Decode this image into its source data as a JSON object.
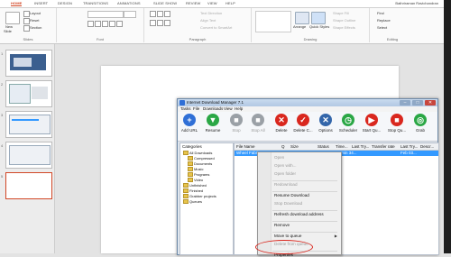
{
  "ribbon": {
    "tabs": [
      "HOME",
      "INSERT",
      "DESIGN",
      "TRANSITIONS",
      "ANIMATIONS",
      "SLIDE SHOW",
      "REVIEW",
      "VIEW",
      "HELP"
    ],
    "account": "Bathriraman Ravichandran",
    "slides_group": {
      "new_slide": "New",
      "new_slide_sub": "Slide",
      "layout": "Layout",
      "reset": "Reset",
      "section": "Section",
      "label": "Slides"
    },
    "font_label": "Font",
    "paragraph_group": {
      "text_direction": "Text Direction",
      "align_text": "Align Text",
      "convert_smartart": "Convert to SmartArt",
      "label": "Paragraph"
    },
    "drawing_group": {
      "arrange": "Arrange",
      "quick_styles": "Quick Styles",
      "shape_fill": "Shape Fill",
      "shape_outline": "Shape Outline",
      "shape_effects": "Shape Effects",
      "label": "Drawing"
    },
    "editing_group": {
      "find": "Find",
      "replace": "Replace",
      "select": "Select",
      "label": "Editing"
    },
    "accent_color": "#d24726"
  },
  "thumbnails": {
    "numbers": [
      "1",
      "2",
      "3",
      "4",
      "5"
    ]
  },
  "idm": {
    "title": "Internet Download Manager 7.1",
    "menu": [
      "Tasks",
      "File",
      "Downloads",
      "View",
      "Help"
    ],
    "toolbar": [
      {
        "label": "Add URL",
        "icon": "add-url-icon",
        "glyph": "+",
        "color": "#2f6fd6",
        "dim": false
      },
      {
        "label": "Resume",
        "icon": "resume-icon",
        "glyph": "▼",
        "color": "#2aa745",
        "dim": false
      },
      {
        "label": "Stop",
        "icon": "stop-icon",
        "glyph": "■",
        "color": "#9aa0a6",
        "dim": true
      },
      {
        "label": "Stop All",
        "icon": "stop-all-icon",
        "glyph": "■",
        "color": "#9aa0a6",
        "dim": true
      },
      {
        "label": "Delete",
        "icon": "delete-icon",
        "glyph": "✕",
        "color": "#d9271e",
        "dim": false
      },
      {
        "label": "Delete C...",
        "icon": "delete-completed-icon",
        "glyph": "✓",
        "color": "#d9271e",
        "dim": false
      },
      {
        "label": "Options",
        "icon": "options-icon",
        "glyph": "✕",
        "color": "#3366aa",
        "dim": false
      },
      {
        "label": "Scheduler",
        "icon": "scheduler-icon",
        "glyph": "◷",
        "color": "#2aa745",
        "dim": false
      },
      {
        "label": "Start Qu...",
        "icon": "start-queue-icon",
        "glyph": "▶",
        "color": "#d9271e",
        "dim": false
      },
      {
        "label": "Stop Qu...",
        "icon": "stop-queue-icon",
        "glyph": "■",
        "color": "#d9271e",
        "dim": false
      },
      {
        "label": "Grab",
        "icon": "grabber-icon",
        "glyph": "◎",
        "color": "#2aa745",
        "dim": false
      }
    ],
    "categories_title": "Categories",
    "categories": [
      {
        "label": "All Downloads",
        "indent": 0
      },
      {
        "label": "Compressed",
        "indent": 1
      },
      {
        "label": "Documents",
        "indent": 1
      },
      {
        "label": "Music",
        "indent": 1
      },
      {
        "label": "Programs",
        "indent": 1
      },
      {
        "label": "Video",
        "indent": 1
      },
      {
        "label": "Unfinished",
        "indent": 0
      },
      {
        "label": "Finished",
        "indent": 0
      },
      {
        "label": "Grabber projects",
        "indent": 0
      },
      {
        "label": "Queues",
        "indent": 0
      }
    ],
    "columns": [
      "File Name",
      "Q",
      "Size",
      "Status",
      "Time...",
      "Last Try...",
      "Transfer rate",
      "Last Try...",
      "Descr..."
    ],
    "selected_row": {
      "name": "Wheel Fabric...",
      "status": "12 min 34...",
      "last_try": "Feb 03..."
    }
  },
  "context_menu": {
    "items": [
      {
        "label": "Open",
        "dim": true
      },
      {
        "label": "Open with...",
        "dim": true
      },
      {
        "label": "Open folder",
        "dim": true
      },
      {
        "label": "Redownload",
        "dim": true,
        "sep_before": true
      },
      {
        "label": "Resume Download",
        "dim": false,
        "sep_before": true
      },
      {
        "label": "Stop Download",
        "dim": true
      },
      {
        "label": "Refresh download address",
        "dim": false,
        "sep_before": true
      },
      {
        "label": "Remove",
        "dim": false,
        "sep_before": true
      },
      {
        "label": "Move to queue",
        "dim": false,
        "sep_before": true,
        "submenu": true
      },
      {
        "label": "Delete from queue",
        "dim": true
      },
      {
        "label": "Properties",
        "dim": false,
        "sep_before": true
      }
    ],
    "highlight_color": "#d9271e"
  }
}
